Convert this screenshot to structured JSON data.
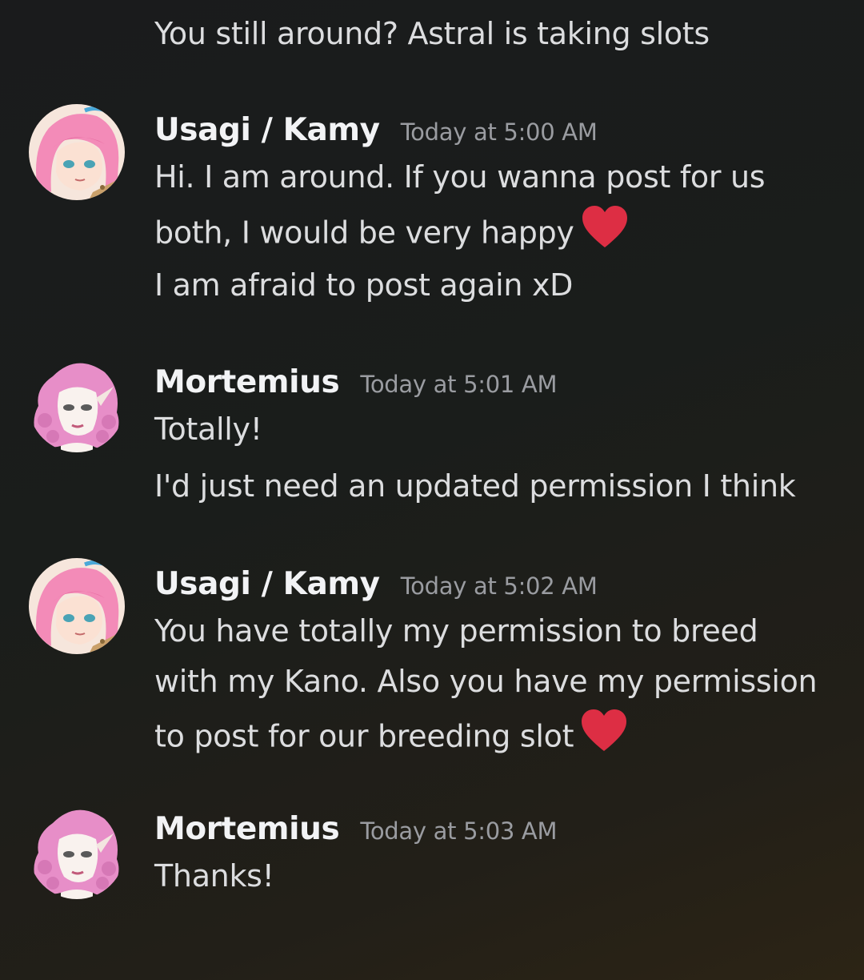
{
  "messages": [
    {
      "continued": true,
      "lines": [
        "You still around? Astral is taking slots"
      ]
    },
    {
      "author": "Usagi / Kamy",
      "avatar_icon": "pink-haired-girl-avatar",
      "time": "Today at 5:00 AM",
      "lines": [
        "Hi. I am around. If you wanna post for us",
        "both, I would be very happy",
        "I am afraid to post again xD"
      ]
    },
    {
      "author": "Mortemius",
      "avatar_icon": "pink-curly-hair-elf-avatar",
      "time": "Today at 5:01 AM",
      "lines": [
        "Totally!",
        "I'd just need an updated permission I think"
      ]
    },
    {
      "author": "Usagi / Kamy",
      "avatar_icon": "pink-haired-girl-avatar",
      "time": "Today at 5:02 AM",
      "lines": [
        "You have totally my permission to breed",
        "with my Kano. Also you have my permission",
        "to post for our breeding slot"
      ]
    },
    {
      "author": "Mortemius",
      "avatar_icon": "pink-curly-hair-elf-avatar",
      "time": "Today at 5:03 AM",
      "lines": [
        "Thanks!"
      ]
    }
  ],
  "emoji": {
    "heart": "heart-emoji"
  },
  "colors": {
    "heart": "#dd2e44",
    "username": "#f2f3f5",
    "timestamp": "#9a9ca1",
    "text": "#dcdddf"
  }
}
